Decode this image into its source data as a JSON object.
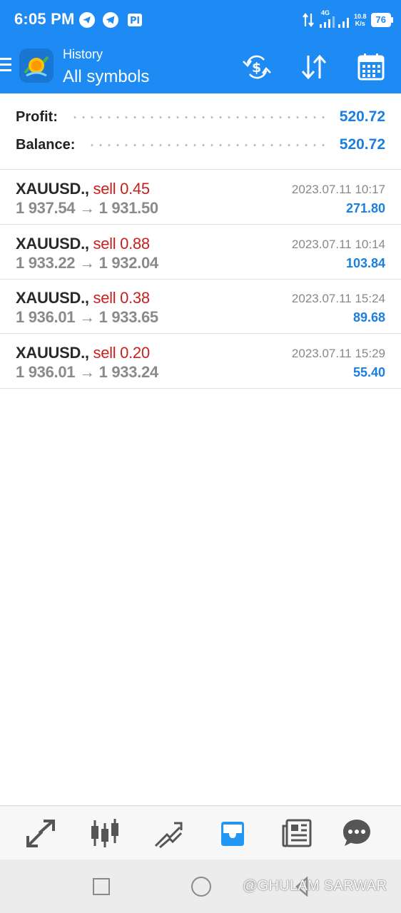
{
  "status_bar": {
    "time": "6:05 PM",
    "network_type": "4G",
    "net_rate_value": "10.8",
    "net_rate_unit": "K/s",
    "battery": "76"
  },
  "app_bar": {
    "subtitle": "History",
    "title": "All symbols",
    "icons": [
      "menu-icon",
      "app-logo",
      "currency-exchange-icon",
      "sort-icon",
      "calendar-icon"
    ]
  },
  "summary": {
    "profit_label": "Profit:",
    "profit_value": "520.72",
    "balance_label": "Balance:",
    "balance_value": "520.72"
  },
  "trades": [
    {
      "symbol": "XAUUSD.,",
      "side": "sell 0.45",
      "open": "1 937.54",
      "arrow": "→",
      "close": "1 931.50",
      "date": "2023.07.11 10:17",
      "profit": "271.80"
    },
    {
      "symbol": "XAUUSD.,",
      "side": "sell 0.88",
      "open": "1 933.22",
      "arrow": "→",
      "close": "1 932.04",
      "date": "2023.07.11 10:14",
      "profit": "103.84"
    },
    {
      "symbol": "XAUUSD.,",
      "side": "sell 0.38",
      "open": "1 936.01",
      "arrow": "→",
      "close": "1 933.65",
      "date": "2023.07.11 15:24",
      "profit": "89.68"
    },
    {
      "symbol": "XAUUSD.,",
      "side": "sell 0.20",
      "open": "1 936.01",
      "arrow": "→",
      "close": "1 933.24",
      "date": "2023.07.11 15:29",
      "profit": "55.40"
    }
  ],
  "bottom_nav": {
    "items": [
      "quotes-icon",
      "chart-icon",
      "trade-icon",
      "history-icon",
      "news-icon",
      "chat-icon"
    ],
    "active": "history-icon"
  },
  "system_nav": {
    "watermark": "@GHULAM SARWAR"
  },
  "colors": {
    "primary": "#1e8af4",
    "profit": "#1a7fe0",
    "sell": "#c8201e",
    "active_nav": "#2196f3",
    "inactive_nav": "#555555"
  }
}
